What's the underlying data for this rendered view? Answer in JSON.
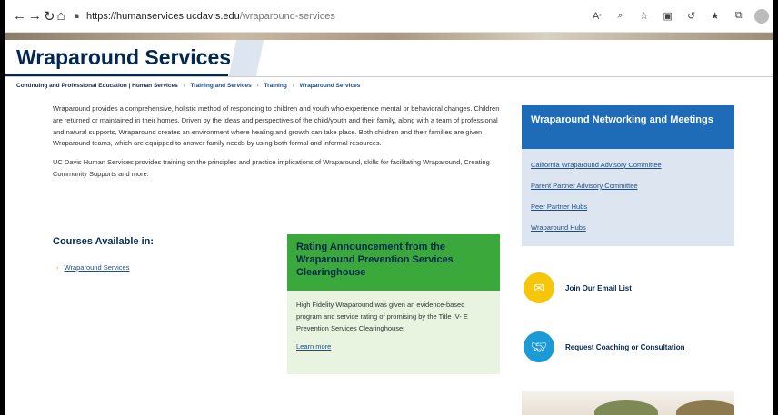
{
  "browser": {
    "url_host": "https://humanservices.ucdavis.edu",
    "url_path": "/wraparound-services",
    "icons": [
      "back-icon",
      "forward-icon",
      "refresh-icon",
      "home-icon",
      "read-aloud-icon",
      "zoom-icon",
      "favorite-add-icon",
      "extension-icon",
      "refresh-circle-icon",
      "favorites-icon",
      "collections-icon",
      "profile-icon",
      "more-icon"
    ]
  },
  "page": {
    "title": "Wraparound Services"
  },
  "breadcrumb": {
    "root": "Continuing and Professional Education | Human Services",
    "items": [
      "Training and Services",
      "Training",
      "Wraparound Services"
    ]
  },
  "intro": {
    "p1": "Wraparound provides a comprehensive, holistic method of responding to children and youth who experience mental or behavioral changes. Children are returned or maintained in their homes. Driven by the ideas and perspectives of the child/youth and their family, along with a team of professional and natural supports, Wraparound creates an environment where healing and growth can take place. Both children and their families are given Wraparound teams, which are equipped to answer family needs by using both formal and informal resources.",
    "p2": "UC Davis Human Services provides training on the principles and practice implications of Wraparound, skills for facilitating Wraparound, Creating Community Supports and more."
  },
  "courses": {
    "title": "Courses Available in:",
    "link": "Wraparound Services"
  },
  "rating": {
    "title": "Rating Announcement from the Wraparound Prevention Services Clearinghouse",
    "body": "High Fidelity Wraparound was given an evidence-based program and service rating of promising by the Title IV- E Prevention Services Clearinghouse!",
    "link": "Learn more"
  },
  "network": {
    "title": "Wraparound Networking and Meetings",
    "links": [
      "California Wraparound Advisory Committee",
      "Parent Partner Advisory Committee",
      "Peer Partner Hubs",
      "Wraparound Hubs"
    ]
  },
  "actions": {
    "email": "Join Our Email List",
    "coaching": "Request Coaching or Consultation"
  },
  "colors": {
    "navy": "#022851",
    "green": "#3aa83a",
    "blue": "#1e6bb8",
    "gold": "#f6c60a",
    "cyan": "#1b9ad6"
  }
}
